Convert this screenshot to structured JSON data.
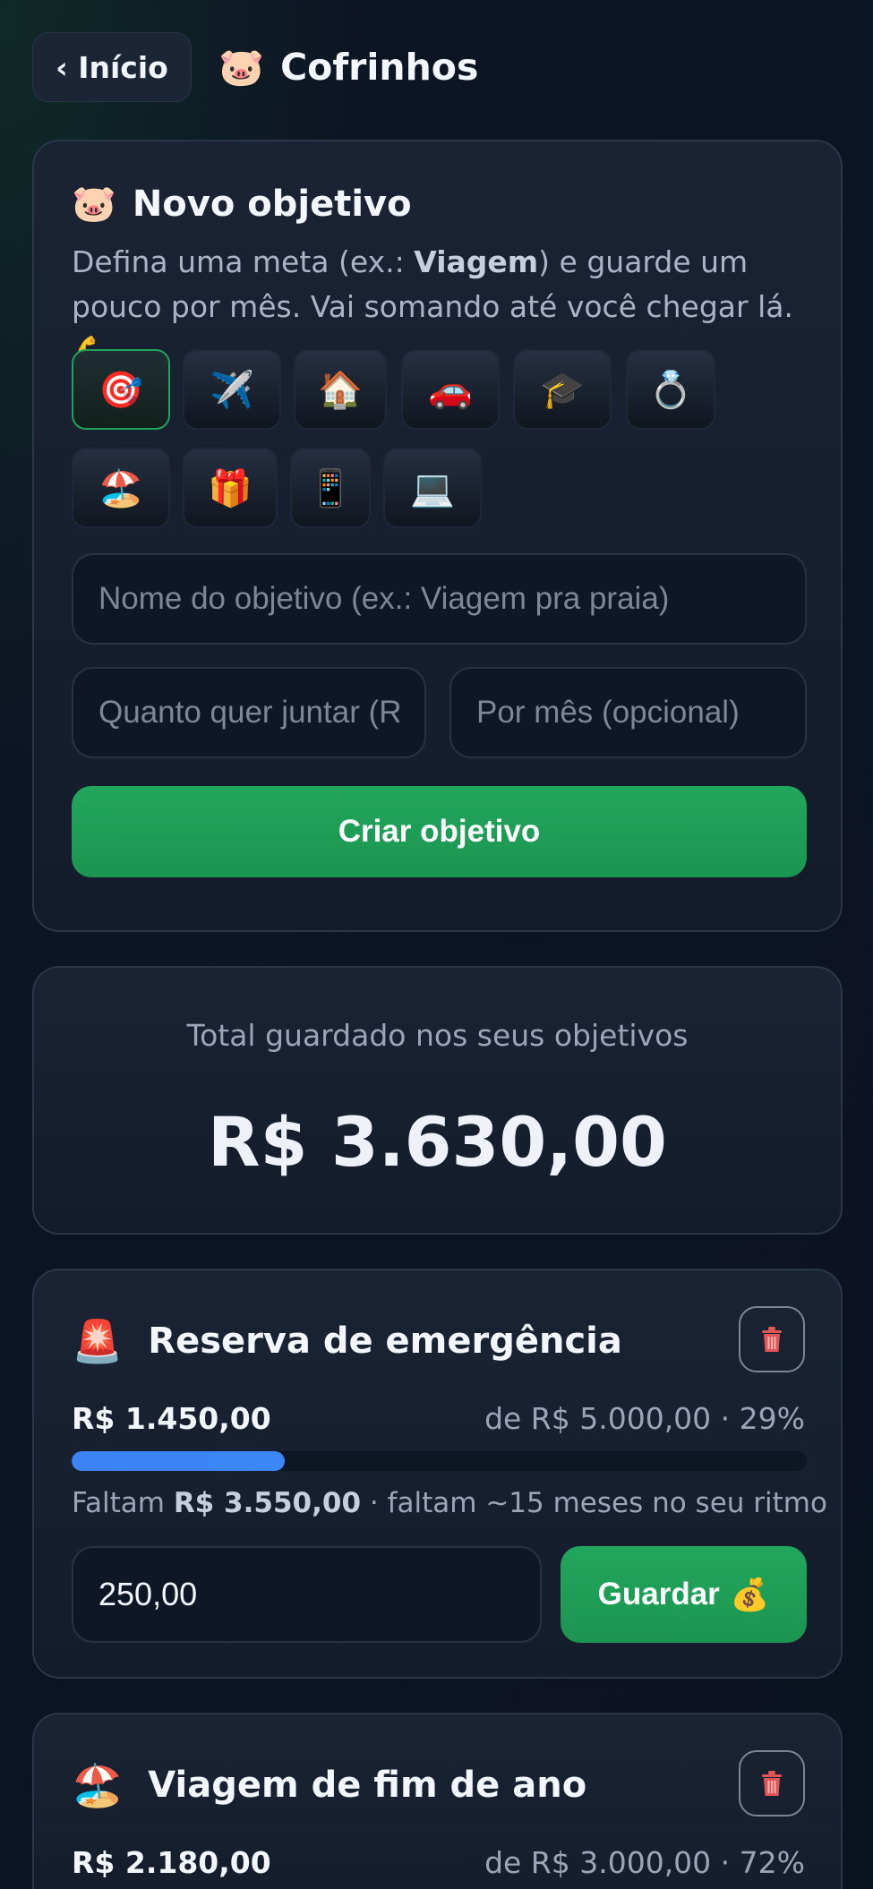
{
  "header": {
    "back_label": "‹ Início",
    "title": "Cofrinhos",
    "title_icon": "🐷"
  },
  "new_goal": {
    "title": "Novo objetivo",
    "title_icon": "🐷",
    "desc_before": "Defina uma meta (ex.: ",
    "desc_bold": "Viagem",
    "desc_after": ") e guarde um pouco por mês. Vai somando até você chegar lá. 💪",
    "icons": [
      {
        "name": "target-icon",
        "glyph": "🎯",
        "selected": true
      },
      {
        "name": "airplane-icon",
        "glyph": "✈️",
        "selected": false
      },
      {
        "name": "house-icon",
        "glyph": "🏠",
        "selected": false
      },
      {
        "name": "car-icon",
        "glyph": "🚗",
        "selected": false
      },
      {
        "name": "graduation-cap-icon",
        "glyph": "🎓",
        "selected": false
      },
      {
        "name": "ring-icon",
        "glyph": "💍",
        "selected": false
      },
      {
        "name": "beach-icon",
        "glyph": "🏖️",
        "selected": false
      },
      {
        "name": "gift-icon",
        "glyph": "🎁",
        "selected": false
      },
      {
        "name": "phone-icon",
        "glyph": "📱",
        "selected": false
      },
      {
        "name": "laptop-icon",
        "glyph": "💻",
        "selected": false
      }
    ],
    "name_placeholder": "Nome do objetivo (ex.: Viagem pra praia)",
    "target_placeholder": "Quanto quer juntar (R$)",
    "monthly_placeholder": "Por mês (opcional)",
    "create_label": "Criar objetivo"
  },
  "total": {
    "label": "Total guardado nos seus objetivos",
    "value": "R$ 3.630,00"
  },
  "goals": [
    {
      "icon": "🚨",
      "icon_name": "siren-icon",
      "name": "Reserva de emergência",
      "saved": "R$ 1.450,00",
      "target_text": "de R$ 5.000,00 · 29%",
      "progress": 0.29,
      "remaining_prefix": "Faltam ",
      "remaining_amount": "R$ 3.550,00",
      "remaining_suffix": " · faltam ~15 meses no seu ritmo",
      "amount_value": "250,00",
      "save_label": "Guardar",
      "save_icon": "💰"
    },
    {
      "icon": "🏖️",
      "icon_name": "beach-icon",
      "name": "Viagem de fim de ano",
      "saved": "R$ 2.180,00",
      "target_text": "de R$ 3.000,00 · 72%",
      "progress": 0.72
    }
  ],
  "colors": {
    "accent_green": "#22a65c",
    "progress_blue": "#3b82f6",
    "background": "#0b1220",
    "card": "#1a2334"
  }
}
